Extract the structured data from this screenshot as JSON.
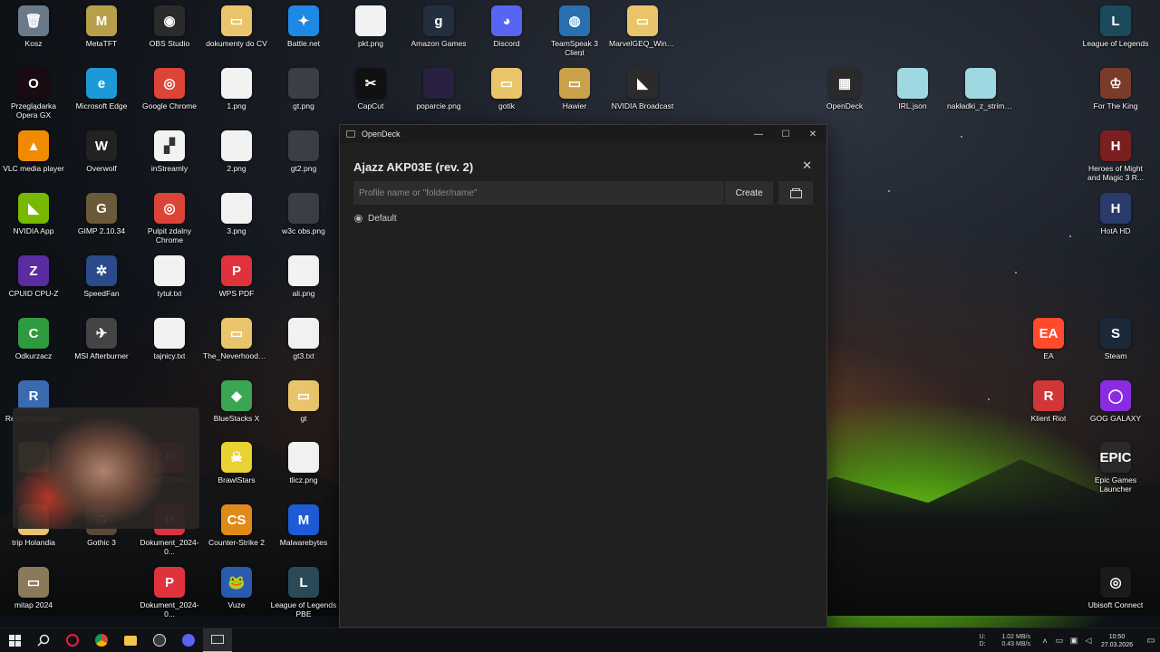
{
  "desktop": {
    "icons": [
      {
        "label": "Kosz",
        "glyph": "🗑",
        "color": "#6b7a8a"
      },
      {
        "label": "MetaTFT",
        "glyph": "M",
        "color": "#b8a04a"
      },
      {
        "label": "OBS Studio",
        "glyph": "◉",
        "color": "#2b2b2b"
      },
      {
        "label": "dokumenty do CV",
        "glyph": "▭",
        "color": "#e9c46a"
      },
      {
        "label": "Battle.net",
        "glyph": "✦",
        "color": "#1e88e5"
      },
      {
        "label": "pkt.png",
        "glyph": "",
        "color": "#f2f2f2"
      },
      {
        "label": "Amazon Games",
        "glyph": "g",
        "color": "#232f3e"
      },
      {
        "label": "Discord",
        "glyph": "◕",
        "color": "#5865f2"
      },
      {
        "label": "TeamSpeak 3 Client",
        "glyph": "◍",
        "color": "#2a6fb0"
      },
      {
        "label": "MarvelGEQ_Windo...",
        "glyph": "▭",
        "color": "#e9c46a"
      },
      {
        "label": "League of Legends",
        "glyph": "L",
        "color": "#1b4a5a"
      },
      {
        "label": "Przeglądarka Opera GX",
        "glyph": "O",
        "color": "#1a0a12"
      },
      {
        "label": "Microsoft Edge",
        "glyph": "e",
        "color": "#1b9ad6"
      },
      {
        "label": "Google Chrome",
        "glyph": "◎",
        "color": "#db4437"
      },
      {
        "label": "1.png",
        "glyph": "",
        "color": "#f2f2f2"
      },
      {
        "label": "gt.png",
        "glyph": "",
        "color": "#3a3f47"
      },
      {
        "label": "CapCut",
        "glyph": "✂",
        "color": "#111111"
      },
      {
        "label": "poparcie.png",
        "glyph": "",
        "color": "#2a2140"
      },
      {
        "label": "gotik",
        "glyph": "▭",
        "color": "#e9c46a"
      },
      {
        "label": "Hawier",
        "glyph": "▭",
        "color": "#caa24a"
      },
      {
        "label": "NVIDIA Broadcast",
        "glyph": "◣",
        "color": "#2b2b2b"
      },
      {
        "label": "OpenDeck",
        "glyph": "▦",
        "color": "#2a2a2a"
      },
      {
        "label": "IRL.json",
        "glyph": "",
        "color": "#9fd8e0"
      },
      {
        "label": "nakładki_z_strime...",
        "glyph": "",
        "color": "#9fd8e0"
      },
      {
        "label": "For The King",
        "glyph": "♔",
        "color": "#7a3b2a"
      },
      {
        "label": "VLC media player",
        "glyph": "▲",
        "color": "#f08a00"
      },
      {
        "label": "Overwolf",
        "glyph": "W",
        "color": "#222222"
      },
      {
        "label": "inStreamly",
        "glyph": "▞",
        "color": "#f2f2f2"
      },
      {
        "label": "2.png",
        "glyph": "",
        "color": "#f2f2f2"
      },
      {
        "label": "gt2.png",
        "glyph": "",
        "color": "#3a3f47"
      },
      {
        "label": "Heroes of Might and Magic 3 R...",
        "glyph": "H",
        "color": "#7a1f1f"
      },
      {
        "label": "NVIDIA App",
        "glyph": "◣",
        "color": "#76b900"
      },
      {
        "label": "GIMP 2.10.34",
        "glyph": "G",
        "color": "#6b5a3a"
      },
      {
        "label": "Pulpit zdalny Chrome",
        "glyph": "◎",
        "color": "#db4437"
      },
      {
        "label": "3.png",
        "glyph": "",
        "color": "#f2f2f2"
      },
      {
        "label": "w3c obs.png",
        "glyph": "",
        "color": "#3a3f47"
      },
      {
        "label": "HotA HD",
        "glyph": "H",
        "color": "#2a3a6a"
      },
      {
        "label": "CPUID CPU-Z",
        "glyph": "Z",
        "color": "#5a2ca0"
      },
      {
        "label": "SpeedFan",
        "glyph": "✲",
        "color": "#2a4a8a"
      },
      {
        "label": "tytuł.txt",
        "glyph": "",
        "color": "#f2f2f2"
      },
      {
        "label": "WPS PDF",
        "glyph": "P",
        "color": "#e0323c"
      },
      {
        "label": "ali.png",
        "glyph": "",
        "color": "#f2f2f2"
      },
      {
        "label": "Odkurzacz",
        "glyph": "C",
        "color": "#2e9b3e"
      },
      {
        "label": "MSI Afterburner",
        "glyph": "✈",
        "color": "#444444"
      },
      {
        "label": "tajnicy.txt",
        "glyph": "",
        "color": "#f2f2f2"
      },
      {
        "label": "The_Neverhood_R...",
        "glyph": "▭",
        "color": "#e9c46a"
      },
      {
        "label": "gt3.txt",
        "glyph": "",
        "color": "#f2f2f2"
      },
      {
        "label": "EA",
        "glyph": "EA",
        "color": "#ff4b2b"
      },
      {
        "label": "Steam",
        "glyph": "S",
        "color": "#1b2838"
      },
      {
        "label": "Revo Uninstaller",
        "glyph": "R",
        "color": "#3a6ab0"
      },
      {
        "label": "BlueStacks X",
        "glyph": "◆",
        "color": "#3aa655"
      },
      {
        "label": "gt",
        "glyph": "▭",
        "color": "#e9c46a"
      },
      {
        "label": "Klient Riot",
        "glyph": "R",
        "color": "#d13639"
      },
      {
        "label": "GOG GALAXY",
        "glyph": "◯",
        "color": "#8a2be2"
      },
      {
        "label": "BrawlStars",
        "glyph": "☠",
        "color": "#e8d234"
      },
      {
        "label": "tlicz.png",
        "glyph": "",
        "color": "#f2f2f2"
      },
      {
        "label": "Epic Games Launcher",
        "glyph": "EPIC",
        "color": "#2a2a2a"
      },
      {
        "label": "trip Holandia",
        "glyph": "▭",
        "color": "#e9c46a"
      },
      {
        "label": "Gothic 3",
        "glyph": "G",
        "color": "#5a4a3a"
      },
      {
        "label": "Dokument_2024-0...",
        "glyph": "P",
        "color": "#e0323c"
      },
      {
        "label": "Counter-Strike 2",
        "glyph": "CS",
        "color": "#e08a1a"
      },
      {
        "label": "Malwarebytes",
        "glyph": "M",
        "color": "#1e5bd6"
      },
      {
        "label": "mitap 2024",
        "glyph": "▭",
        "color": "#8a7a5a"
      },
      {
        "label": "Dokument_2024-0...",
        "glyph": "P",
        "color": "#e0323c"
      },
      {
        "label": "Vuze",
        "glyph": "🐸",
        "color": "#2a5ab0"
      },
      {
        "label": "League of Legends PBE",
        "glyph": "L",
        "color": "#2a4a5a"
      },
      {
        "label": "Ubisoft Connect",
        "glyph": "◎",
        "color": "#1a1a1a"
      },
      {
        "label": "Er...",
        "glyph": "▭",
        "color": "#e9c46a"
      },
      {
        "label": "...ent_2024-0...",
        "glyph": "P",
        "color": "#e0323c"
      }
    ]
  },
  "window": {
    "title": "OpenDeck",
    "device_title": "Ajazz AKP03E (rev. 2)",
    "profile_input": {
      "value": "",
      "placeholder": "Profile name or \"folder/name\""
    },
    "create_label": "Create",
    "profiles": [
      {
        "label": "Default",
        "selected": true
      }
    ],
    "controls": {
      "minimize": "—",
      "maximize": "☐",
      "close": "✕"
    }
  },
  "taskbar": {
    "network": {
      "up_label": "U:",
      "up_value": "1.02 MB/s",
      "down_label": "D:",
      "down_value": "0.43 MB/s"
    },
    "clock": {
      "time": "10:50",
      "date": "27.03.2026"
    }
  }
}
